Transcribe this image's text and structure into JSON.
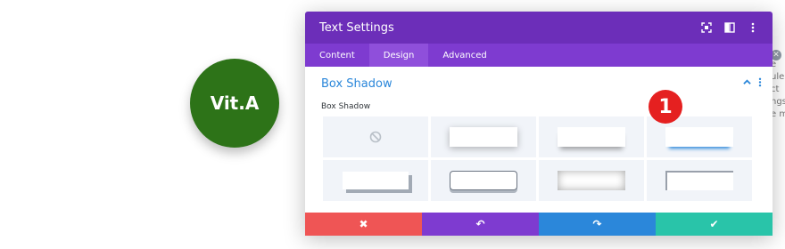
{
  "circle": {
    "label": "Vit.A"
  },
  "background_text": {
    "lines": [
      "e",
      "ule",
      "ct",
      "ngs",
      "e m"
    ]
  },
  "modal": {
    "title": "Text Settings",
    "tabs": [
      {
        "label": "Content"
      },
      {
        "label": "Design"
      },
      {
        "label": "Advanced"
      }
    ],
    "section": {
      "title": "Box Shadow"
    },
    "field_label": "Box Shadow"
  },
  "annotation": {
    "label": "1"
  },
  "colors": {
    "header_purple": "#6c2eb9",
    "tab_purple": "#7e3bd0",
    "accent_blue": "#2b87da",
    "cancel_red": "#ef5555",
    "save_green": "#29c4a9",
    "circle_green": "#2d7318",
    "badge_red": "#e52020"
  },
  "icons": {
    "header": [
      "expand-icon",
      "columns-icon",
      "more-options-icon"
    ],
    "section": [
      "chevron-up-icon",
      "more-options-icon"
    ],
    "footer": [
      "close-icon",
      "undo-icon",
      "redo-icon",
      "check-icon"
    ]
  },
  "footer": {
    "cancel": "✖",
    "undo": "↶",
    "redo": "↷",
    "save": "✔"
  }
}
